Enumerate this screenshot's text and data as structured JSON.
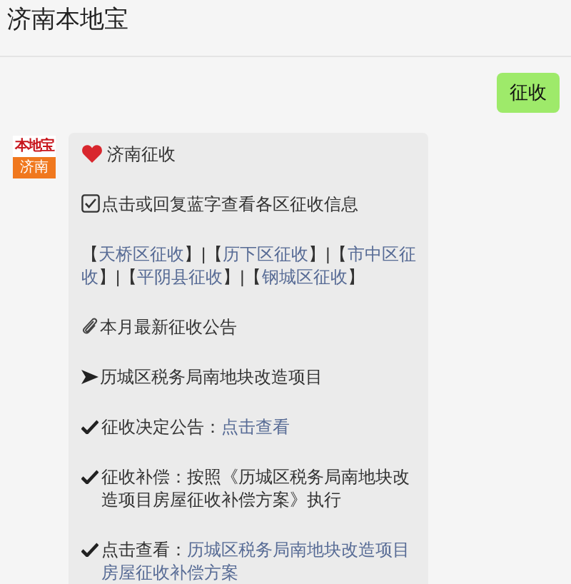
{
  "header": {
    "title": "济南本地宝"
  },
  "messages": [
    {
      "kind": "sent",
      "text": "征收"
    },
    {
      "kind": "received",
      "avatar": {
        "top": "本地宝",
        "bottom": "济南"
      },
      "paragraphs": [
        {
          "kind": "heart",
          "segments": [
            {
              "text": "济南征收",
              "link": false
            }
          ]
        },
        {
          "kind": "checkbox",
          "segments": [
            {
              "text": "点击或回复蓝字查看各区征收信息",
              "link": false
            }
          ]
        },
        {
          "kind": "plain",
          "segments": [
            {
              "text": "【",
              "link": false
            },
            {
              "text": "天桥区征收",
              "link": true
            },
            {
              "text": "】|【",
              "link": false
            },
            {
              "text": "历下区征收",
              "link": true
            },
            {
              "text": "】|【",
              "link": false
            },
            {
              "text": "市中区征",
              "link": true
            },
            {
              "text": "收",
              "link": true
            },
            {
              "text": "】|【",
              "link": false
            },
            {
              "text": "平阴县征收",
              "link": true
            },
            {
              "text": "】|【",
              "link": false
            },
            {
              "text": "钢城区征收",
              "link": true
            },
            {
              "text": "】",
              "link": false
            }
          ]
        },
        {
          "kind": "paperclip",
          "segments": [
            {
              "text": "本月最新征收公告",
              "link": false
            }
          ]
        },
        {
          "kind": "arrow",
          "segments": [
            {
              "text": "历城区税务局南地块改造项目",
              "link": false
            }
          ]
        },
        {
          "kind": "check",
          "segments": [
            {
              "text": "征收决定公告：",
              "link": false
            },
            {
              "text": "点击查看",
              "link": true
            }
          ]
        },
        {
          "kind": "check",
          "segments": [
            {
              "text": "征收补偿：按照《历城区税务局南地块改造项目房屋征收补偿方案》执行",
              "link": false
            }
          ]
        },
        {
          "kind": "check",
          "segments": [
            {
              "text": "点击查看：",
              "link": false
            },
            {
              "text": "历城区税务局南地块改造项目",
              "link": true
            },
            {
              "text": "房屋征收补偿方案",
              "link": true
            }
          ]
        }
      ]
    }
  ]
}
